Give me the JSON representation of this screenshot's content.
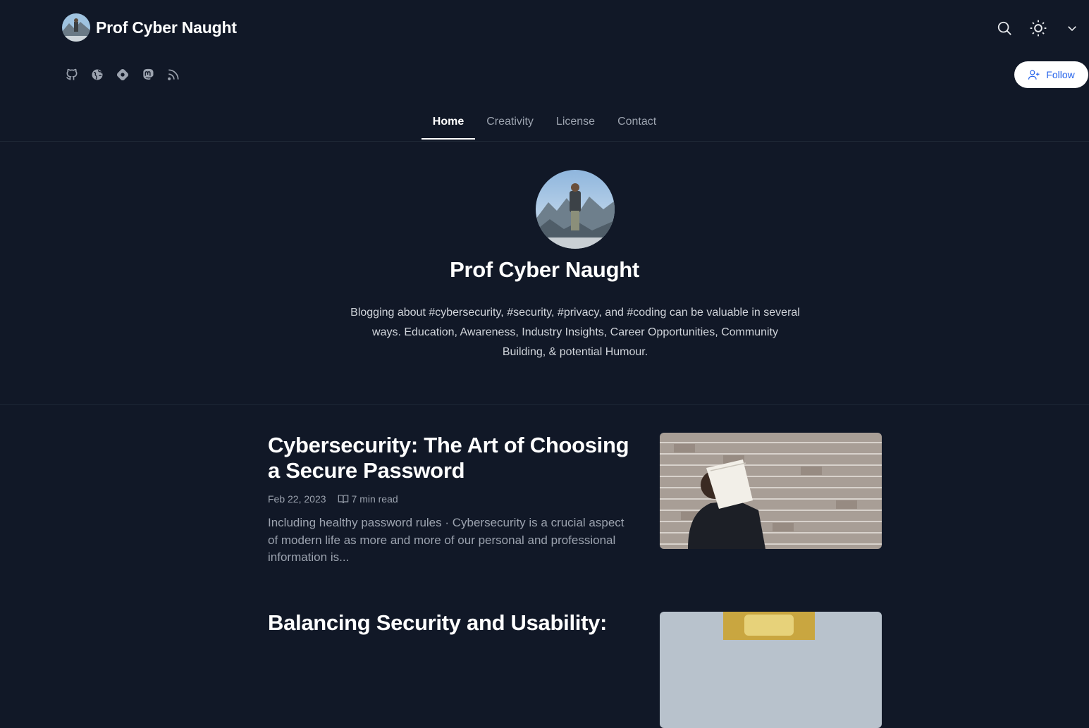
{
  "brand": {
    "title": "Prof Cyber Naught"
  },
  "follow": {
    "label": "Follow"
  },
  "nav": {
    "items": [
      "Home",
      "Creativity",
      "License",
      "Contact"
    ]
  },
  "profile": {
    "name": "Prof Cyber Naught",
    "bio": "Blogging about #cybersecurity, #security, #privacy, and #coding can be valuable in several ways. Education, Awareness, Industry Insights, Career Opportunities, Community Building, & potential Humour."
  },
  "posts": [
    {
      "title": "Cybersecurity: The Art of Choosing a Secure Password",
      "date": "Feb 22, 2023",
      "read_time": "7 min read",
      "excerpt": "Including healthy password rules · Cybersecurity is a crucial aspect of modern life as more and more of our personal and professional information is..."
    },
    {
      "title": "Balancing Security and Usability:"
    }
  ],
  "icons": [
    "search-icon",
    "sun-icon",
    "chevron-down-icon",
    "github-icon",
    "globe-icon",
    "hashnode-icon",
    "mastodon-icon",
    "rss-icon",
    "user-plus-icon",
    "book-open-icon"
  ]
}
